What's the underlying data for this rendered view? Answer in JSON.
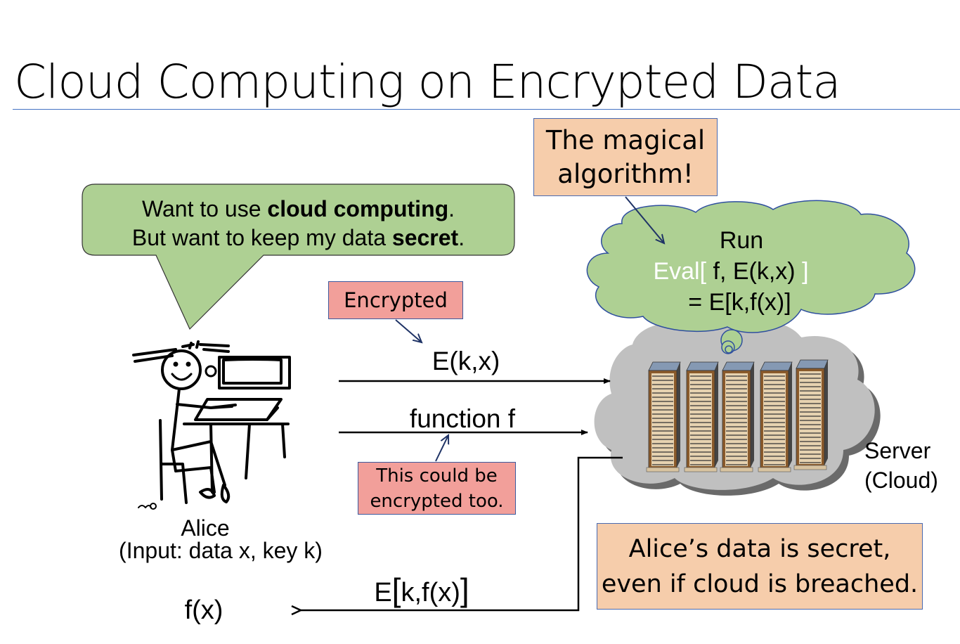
{
  "slide": {
    "title": "Cloud Computing on Encrypted Data"
  },
  "speech_bubble": {
    "line1_pre": "Want to use ",
    "line1_bold": "cloud computing",
    "line1_post": ".",
    "line2_pre": "But want to keep my data ",
    "line2_bold": "secret",
    "line2_post": "."
  },
  "magical_box": {
    "line1": "The magical",
    "line2": "algorithm!"
  },
  "thought_cloud": {
    "line1": "Run",
    "eval_word": "Eval",
    "eval_open": "[",
    "eval_args": " f, E(k,x) ",
    "eval_close": "]",
    "line3": "=  E[k,f(x)]"
  },
  "server_label": {
    "line1": "Server",
    "line2": "(Cloud)"
  },
  "encrypted_note": "Encrypted",
  "arrow_labels": {
    "to_server_data": "E(k,x)",
    "to_server_function": "function f",
    "return_value_pre": "E",
    "return_value_open": "[",
    "return_value_mid": "k,f(x)",
    "return_value_close": "]",
    "result": "f(x)"
  },
  "function_note": {
    "line1": "This could be",
    "line2": "encrypted too."
  },
  "alice": {
    "name": "Alice",
    "inputs": "(Input: data x, key k)"
  },
  "conclusion": {
    "line1": "Alice’s data is secret,",
    "line2": "even if cloud is breached."
  },
  "colors": {
    "title_rule": "#4472c4",
    "bubble_green": "#aed093",
    "peach": "#f6cdab",
    "pink": "#f29f9a",
    "cloud_gray": "#c0c0c0",
    "outline_blue": "#2f4f8f",
    "eval_white": "#ffffff"
  }
}
